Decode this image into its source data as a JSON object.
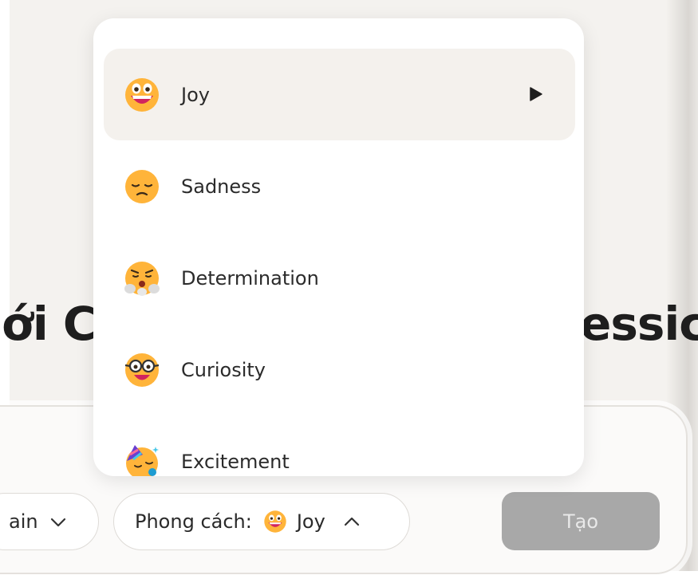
{
  "hero": {
    "title_left": "ới C",
    "title_right": "essic"
  },
  "emotion_menu": {
    "items": [
      {
        "label": "Joy",
        "icon": "grinning-face-icon",
        "active": true
      },
      {
        "label": "Sadness",
        "icon": "pensive-face-icon",
        "active": false
      },
      {
        "label": "Determination",
        "icon": "steaming-face-icon",
        "active": false
      },
      {
        "label": "Curiosity",
        "icon": "nerd-glasses-face-icon",
        "active": false
      },
      {
        "label": "Excitement",
        "icon": "party-face-icon",
        "active": false
      }
    ],
    "submenu_icon": "play-arrow-icon"
  },
  "toolbar": {
    "model_label": "ain",
    "style_prefix": "Phong cách:",
    "style_value": "Joy",
    "create_label": "Tạo"
  },
  "colors": {
    "background": "#f4f2ef",
    "menu_active": "#f4f1ed",
    "emoji_yellow": "#ffb43a",
    "create_button": "#a8a8a8"
  }
}
